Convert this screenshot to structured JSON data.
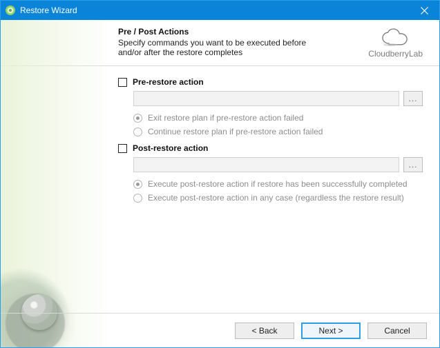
{
  "window": {
    "title": "Restore Wizard"
  },
  "brand": {
    "name": "CloudberryLab"
  },
  "header": {
    "title": "Pre / Post Actions",
    "subtitle": "Specify commands you want to be executed before and/or after the restore completes"
  },
  "pre": {
    "checkbox_label": "Pre-restore action",
    "checked": false,
    "command": "",
    "browse_label": "...",
    "radios": {
      "selected": 0,
      "options": [
        "Exit restore plan if pre-restore action failed",
        "Continue restore plan if pre-restore action failed"
      ]
    }
  },
  "post": {
    "checkbox_label": "Post-restore action",
    "checked": false,
    "command": "",
    "browse_label": "...",
    "radios": {
      "selected": 0,
      "options": [
        "Execute post-restore action if restore has been successfully completed",
        "Execute post-restore action in any case (regardless the restore result)"
      ]
    }
  },
  "footer": {
    "back": "< Back",
    "next": "Next >",
    "cancel": "Cancel"
  },
  "icons": {
    "app": "app-icon",
    "close": "close-icon",
    "cloud": "cloud-icon"
  }
}
